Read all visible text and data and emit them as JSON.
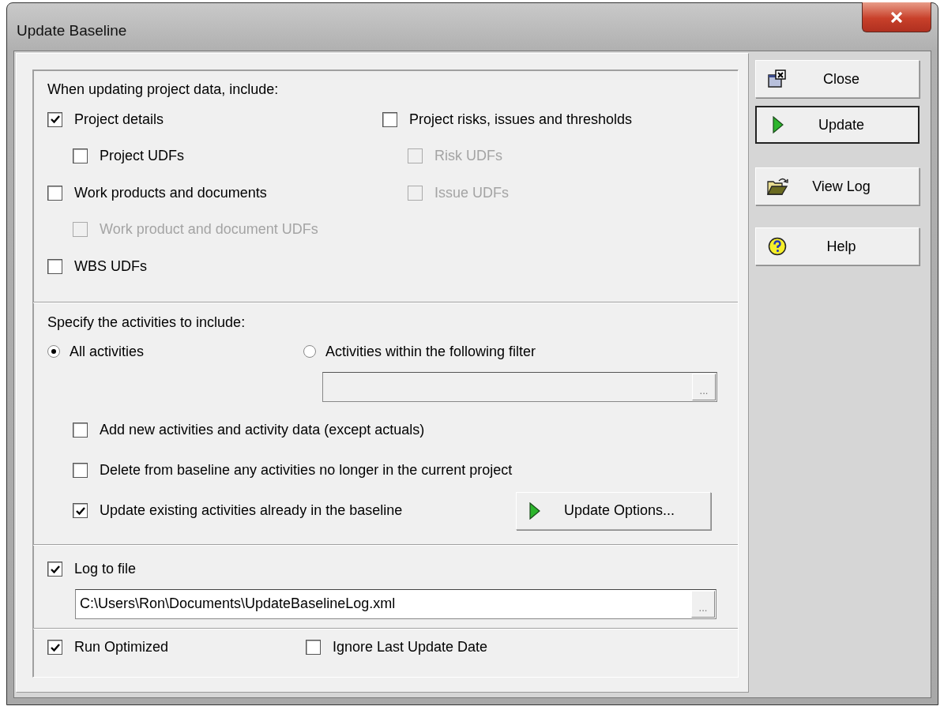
{
  "window": {
    "title": "Update Baseline"
  },
  "include": {
    "heading": "When updating project data, include:",
    "left": [
      {
        "label": "Project details",
        "checked": true,
        "disabled": false,
        "children": [
          {
            "label": "Project UDFs",
            "checked": false,
            "disabled": false
          }
        ]
      },
      {
        "label": "Work products and documents",
        "checked": false,
        "disabled": false,
        "children": [
          {
            "label": "Work product and document UDFs",
            "checked": false,
            "disabled": true
          }
        ]
      },
      {
        "label": "WBS UDFs",
        "checked": false,
        "disabled": false
      }
    ],
    "right": [
      {
        "label": "Project risks, issues and thresholds",
        "checked": false,
        "disabled": false,
        "children": [
          {
            "label": "Risk UDFs",
            "checked": false,
            "disabled": true
          },
          {
            "label": "Issue UDFs",
            "checked": false,
            "disabled": true
          }
        ]
      }
    ]
  },
  "activities": {
    "heading": "Specify the activities to include:",
    "radios": [
      {
        "label": "All activities",
        "selected": true
      },
      {
        "label": "Activities within the following filter",
        "selected": false
      }
    ],
    "filter_button": "...",
    "options": [
      {
        "label": "Add new activities and activity data (except actuals)",
        "checked": false
      },
      {
        "label": "Delete from baseline any activities no longer in the current project",
        "checked": false
      },
      {
        "label": "Update existing activities already in the baseline",
        "checked": true
      }
    ],
    "options_button": "Update Options..."
  },
  "log": {
    "label": "Log to file",
    "checked": true,
    "path": "C:\\Users\\Ron\\Documents\\UpdateBaselineLog.xml",
    "browse_button": "..."
  },
  "run": [
    {
      "label": "Run Optimized",
      "checked": true
    },
    {
      "label": "Ignore Last Update Date",
      "checked": false
    }
  ],
  "buttons": [
    {
      "label": "Close",
      "kind": "close",
      "default": false
    },
    {
      "label": "Update",
      "kind": "play",
      "default": true
    },
    {
      "label": "View Log",
      "kind": "folder",
      "default": false
    },
    {
      "label": "Help",
      "kind": "help",
      "default": false
    }
  ]
}
